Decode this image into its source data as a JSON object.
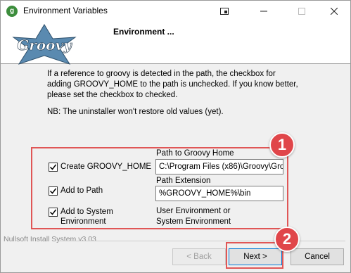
{
  "window": {
    "title": "Environment Variables",
    "header_title": "Environment ...",
    "logo_text": "Groovy"
  },
  "content": {
    "description": "If a reference to groovy is detected in the path, the checkbox for adding GROOVY_HOME to the path is unchecked. If you know better, please set the checkbox to checked.",
    "note": "NB: The uninstaller won't restore old values (yet)."
  },
  "options": {
    "create_groovy_home": {
      "label": "Create GROOVY_HOME",
      "checked": true
    },
    "add_to_path": {
      "label": "Add to Path",
      "checked": true
    },
    "add_to_system_env": {
      "label_line1": "Add to System",
      "label_line2": "Environment",
      "checked": true
    }
  },
  "fields": {
    "groovy_home_label": "Path to Groovy Home",
    "groovy_home_value": "C:\\Program Files (x86)\\Groovy\\Groo",
    "path_ext_label": "Path Extension",
    "path_ext_value": "%GROOVY_HOME%\\bin",
    "env_scope_line1": "User Environment or",
    "env_scope_line2": "System Environment"
  },
  "footer": {
    "installer_label": "Nullsoft Install System v3.03",
    "back_label": "< Back",
    "next_label": "Next >",
    "cancel_label": "Cancel"
  },
  "annotations": {
    "badge1": "1",
    "badge2": "2",
    "color": "#e0464a"
  }
}
